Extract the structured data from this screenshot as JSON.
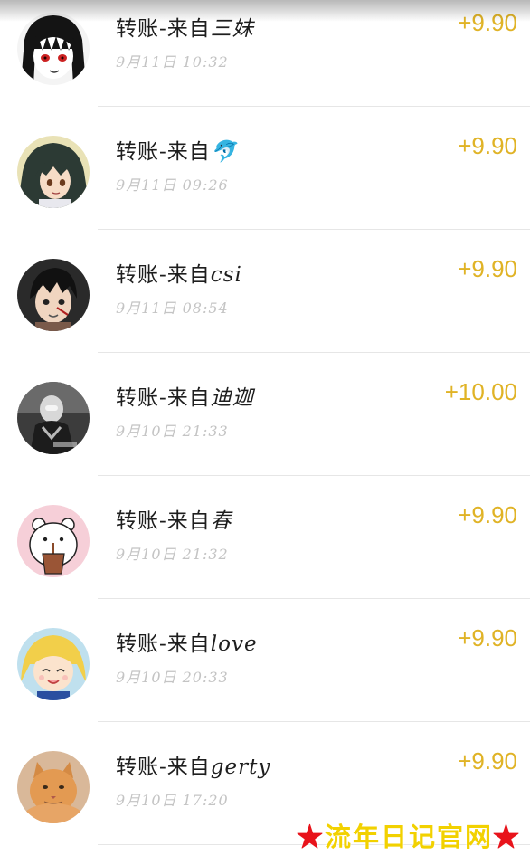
{
  "transactions": [
    {
      "title": "转账-来自",
      "sender": "三妹",
      "time": "9月11日 10:32",
      "amount": "+9.90",
      "avatar_icon": "anime-girl-red-eyes"
    },
    {
      "title": "转账-来自",
      "sender": "🐬",
      "time": "9月11日 09:26",
      "amount": "+9.90",
      "avatar_icon": "anime-girl-dark-hair"
    },
    {
      "title": "转账-来自",
      "sender": "csi",
      "time": "9月11日 08:54",
      "amount": "+9.90",
      "avatar_icon": "anime-boy-dark-hair"
    },
    {
      "title": "转账-来自",
      "sender": "迪迦",
      "time": "9月10日 21:33",
      "amount": "+10.00",
      "avatar_icon": "ultraman-figure"
    },
    {
      "title": "转账-来自",
      "sender": "春",
      "time": "9月10日 21:32",
      "amount": "+9.90",
      "avatar_icon": "white-bear-drinking"
    },
    {
      "title": "转账-来自",
      "sender": "love",
      "time": "9月10日 20:33",
      "amount": "+9.90",
      "avatar_icon": "sailor-moon-smiling"
    },
    {
      "title": "转账-来自",
      "sender": "gerty",
      "time": "9月10日 17:20",
      "amount": "+9.90",
      "avatar_icon": "orange-cat-photo"
    }
  ],
  "watermark": {
    "star_left": "★",
    "text": "流年日记官网",
    "star_right": "★"
  },
  "colors": {
    "amount": "#e0b326",
    "time": "#c4c4c4",
    "watermark_text": "#f2d100",
    "watermark_star": "#e8131b"
  }
}
